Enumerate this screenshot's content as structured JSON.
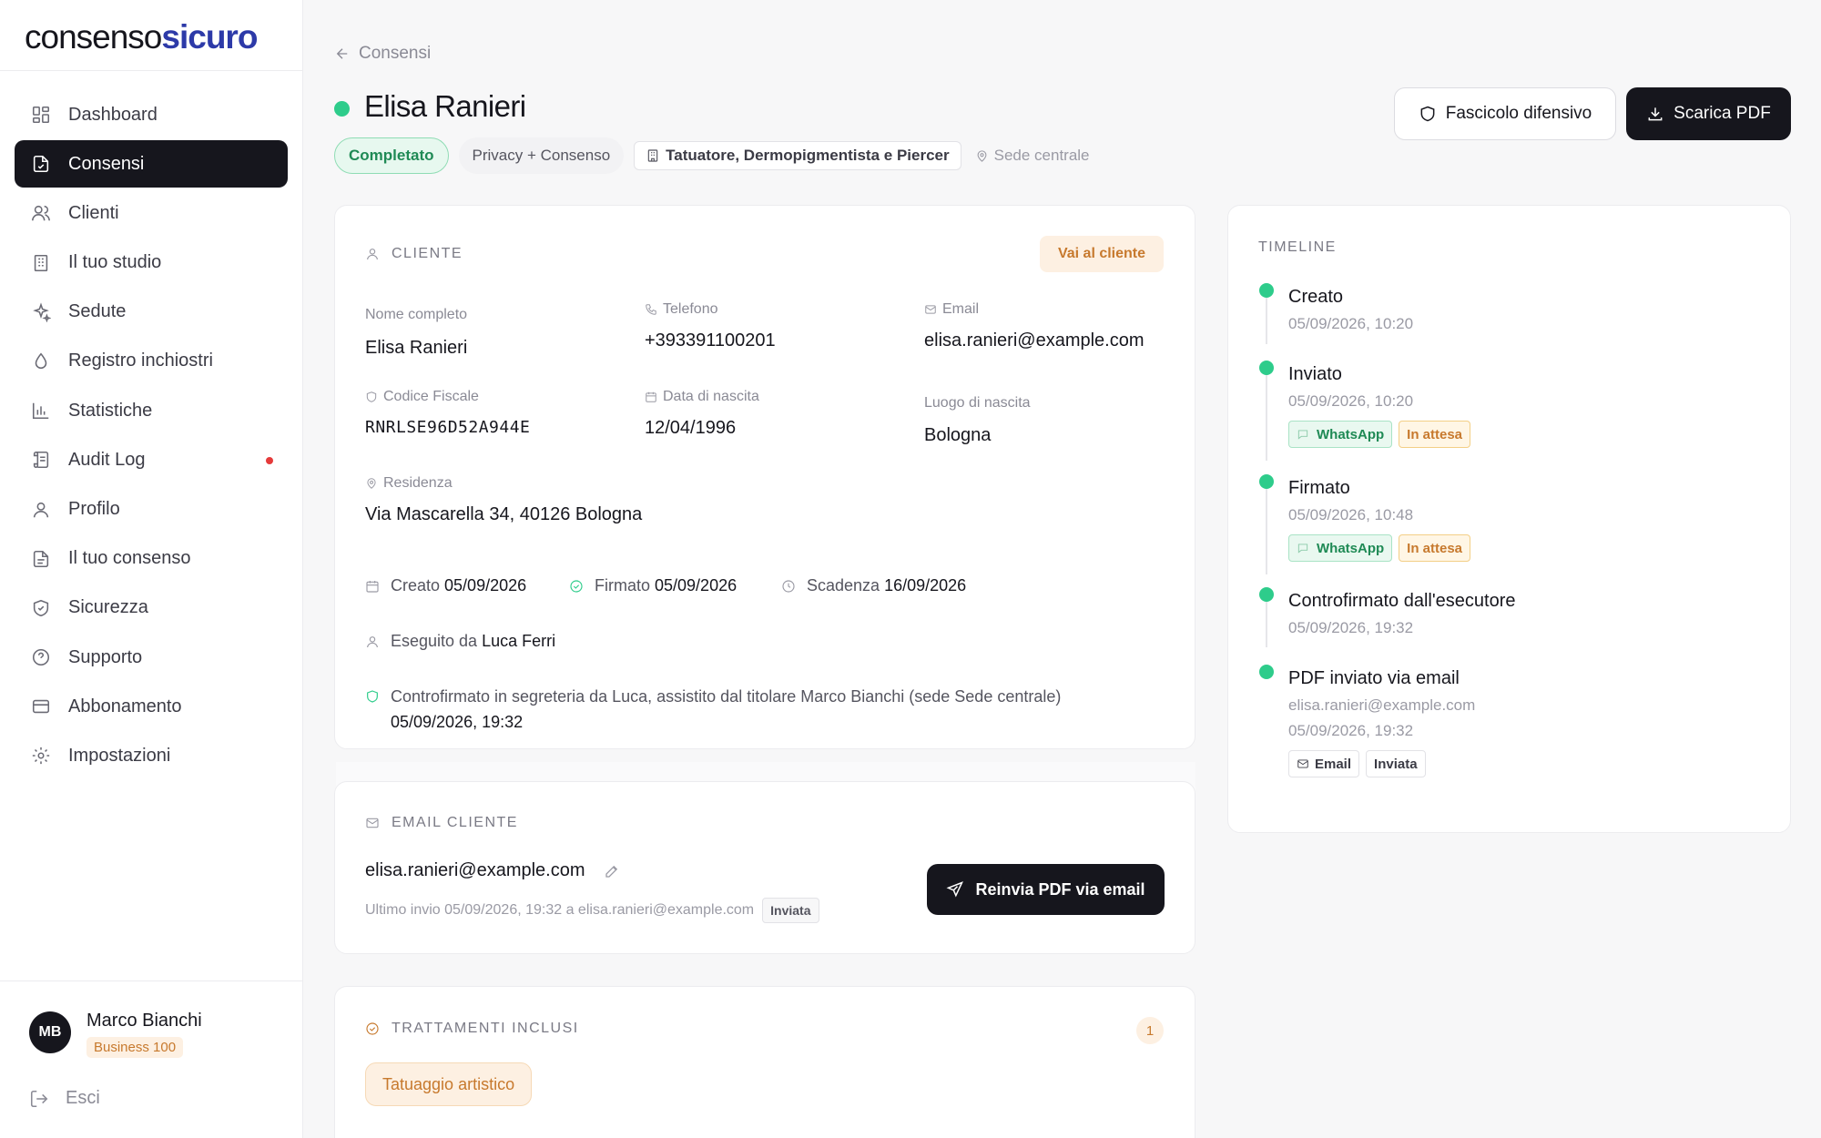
{
  "logo": {
    "part1": "consenso",
    "part2": "sicuro"
  },
  "sidebar": {
    "items": [
      {
        "label": "Dashboard"
      },
      {
        "label": "Consensi"
      },
      {
        "label": "Clienti"
      },
      {
        "label": "Il tuo studio"
      },
      {
        "label": "Sedute"
      },
      {
        "label": "Registro inchiostri"
      },
      {
        "label": "Statistiche"
      },
      {
        "label": "Audit Log"
      },
      {
        "label": "Profilo"
      },
      {
        "label": "Il tuo consenso"
      },
      {
        "label": "Sicurezza"
      },
      {
        "label": "Supporto"
      },
      {
        "label": "Abbonamento"
      },
      {
        "label": "Impostazioni"
      }
    ],
    "active_item": "Consensi",
    "user": {
      "initials": "MB",
      "name": "Marco Bianchi",
      "plan": "Business 100"
    },
    "logout_label": "Esci"
  },
  "header": {
    "back_label": "Consensi",
    "title": "Elisa Ranieri",
    "status": "Completato",
    "type": "Privacy + Consenso",
    "profession": "Tatuatore, Dermopigmentista e Piercer",
    "location": "Sede centrale",
    "btn_fascicolo": "Fascicolo difensivo",
    "btn_pdf": "Scarica PDF"
  },
  "cliente": {
    "section_title": "CLIENTE",
    "goto_label": "Vai al cliente",
    "fields": {
      "nome_label": "Nome completo",
      "nome": "Elisa Ranieri",
      "telefono_label": "Telefono",
      "telefono": "+393391100201",
      "email_label": "Email",
      "email": "elisa.ranieri@example.com",
      "cf_label": "Codice Fiscale",
      "cf": "RNRLSE96D52A944E",
      "nascita_label": "Data di nascita",
      "nascita": "12/04/1996",
      "luogo_label": "Luogo di nascita",
      "luogo": "Bologna",
      "residenza_label": "Residenza",
      "residenza": "Via Mascarella 34, 40126 Bologna"
    },
    "meta": {
      "creato_label": "Creato",
      "creato": "05/09/2026",
      "firmato_label": "Firmato",
      "firmato": "05/09/2026",
      "scadenza_label": "Scadenza",
      "scadenza": "16/09/2026",
      "eseguito_label": "Eseguito da",
      "eseguito": "Luca Ferri",
      "controfirma_line1": "Controfirmato in segreteria da Luca, assistito dal titolare Marco Bianchi (sede Sede centrale)",
      "controfirma_line2": "05/09/2026, 19:32"
    }
  },
  "email_cliente": {
    "section_title": "EMAIL CLIENTE",
    "email": "elisa.ranieri@example.com",
    "last_send": "Ultimo invio 05/09/2026, 19:32 a elisa.ranieri@example.com",
    "last_send_status": "Inviata",
    "resend_label": "Reinvia PDF via email"
  },
  "trattamenti": {
    "section_title": "TRATTAMENTI INCLUSI",
    "count": "1",
    "items": [
      "Tatuaggio artistico"
    ]
  },
  "timeline": {
    "title": "TIMELINE",
    "events": [
      {
        "title": "Creato",
        "time": "05/09/2026, 10:20"
      },
      {
        "title": "Inviato",
        "time": "05/09/2026, 10:20",
        "channel": "WhatsApp",
        "state": "In attesa"
      },
      {
        "title": "Firmato",
        "time": "05/09/2026, 10:48",
        "channel": "WhatsApp",
        "state": "In attesa"
      },
      {
        "title": "Controfirmato dall'esecutore",
        "time": "05/09/2026, 19:32"
      },
      {
        "title": "PDF inviato via email",
        "detail": "elisa.ranieri@example.com",
        "time": "05/09/2026, 19:32",
        "channel": "Email",
        "state": "Inviata"
      }
    ]
  },
  "colors": {
    "accent_green": "#2ecc8b",
    "dark": "#16161d",
    "orange": "#c7792d",
    "brand_blue": "#2d3aa8"
  }
}
